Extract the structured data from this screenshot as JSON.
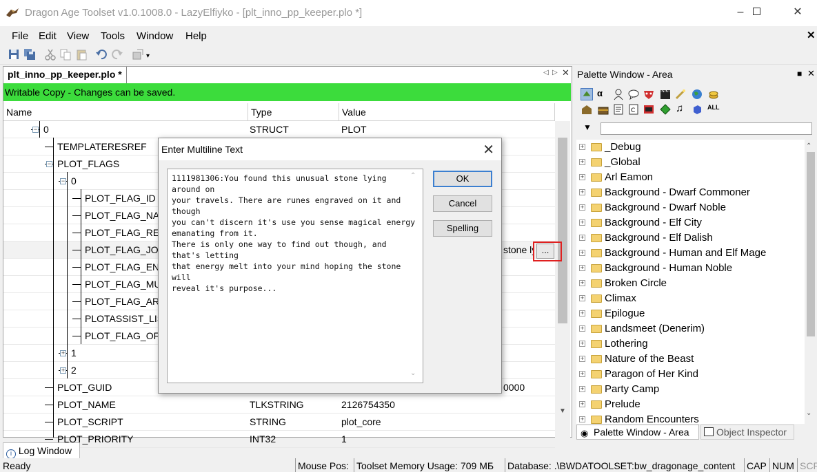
{
  "window": {
    "title": "Dragon Age Toolset v1.0.1008.0 - LazyElfiyko - [plt_inno_pp_keeper.plo *]"
  },
  "menu": [
    "File",
    "Edit",
    "View",
    "Tools",
    "Window",
    "Help"
  ],
  "document": {
    "tab_label": "plt_inno_pp_keeper.plo *",
    "status_banner": "Writable Copy - Changes can be saved.",
    "columns": {
      "name": "Name",
      "type": "Type",
      "value": "Value"
    },
    "rows": [
      {
        "name": "0",
        "type": "STRUCT",
        "value": "PLOT"
      },
      {
        "name": "TEMPLATERESREF",
        "type": "",
        "value": ""
      },
      {
        "name": "PLOT_FLAGS",
        "type": "",
        "value": ""
      },
      {
        "name": "0",
        "type": "",
        "value": ""
      },
      {
        "name": "PLOT_FLAG_ID",
        "type": "",
        "value": ""
      },
      {
        "name": "PLOT_FLAG_NAM",
        "type": "",
        "value": ""
      },
      {
        "name": "PLOT_FLAG_REW",
        "type": "",
        "value": ""
      },
      {
        "name": "PLOT_FLAG_JOU",
        "type": "",
        "value": "stone lyi"
      },
      {
        "name": "PLOT_FLAG_END",
        "type": "",
        "value": ""
      },
      {
        "name": "PLOT_FLAG_MUL",
        "type": "",
        "value": ""
      },
      {
        "name": "PLOT_FLAG_ARE",
        "type": "",
        "value": ""
      },
      {
        "name": "PLOTASSIST_LIST",
        "type": "",
        "value": ""
      },
      {
        "name": "PLOT_FLAG_OFF",
        "type": "",
        "value": ""
      },
      {
        "name": "1",
        "type": "",
        "value": ""
      },
      {
        "name": "2",
        "type": "",
        "value": ""
      },
      {
        "name": "PLOT_GUID",
        "type": "",
        "value": "0000"
      },
      {
        "name": "PLOT_NAME",
        "type": "TLKSTRING",
        "value": "2126754350"
      },
      {
        "name": "PLOT_SCRIPT",
        "type": "STRING",
        "value": "plot_core"
      },
      {
        "name": "PLOT_PRIORITY",
        "type": "INT32",
        "value": "1"
      }
    ],
    "ellipsis_button": "..."
  },
  "dialog": {
    "title": "Enter Multiline Text",
    "text": "1111981306:You found this unusual stone lying around on\nyour travels. There are runes engraved on it and though\nyou can't discern it's use you sense magical energy\nemanating from it.\nThere is only one way to find out though, and that's letting\nthat energy melt into your mind hoping the stone will\nreveal it's purpose...",
    "ok": "OK",
    "cancel": "Cancel",
    "spelling": "Spelling"
  },
  "palette": {
    "title": "Palette Window - Area",
    "items": [
      "_Debug",
      "_Global",
      "Arl Eamon",
      "Background - Dwarf Commoner",
      "Background - Dwarf Noble",
      "Background - Elf City",
      "Background - Elf Dalish",
      "Background - Human and Elf Mage",
      "Background - Human Noble",
      "Broken Circle",
      "Climax",
      "Epilogue",
      "Landsmeet (Denerim)",
      "Lothering",
      "Nature of the Beast",
      "Paragon of Her Kind",
      "Party Camp",
      "Prelude",
      "Random Encounters"
    ],
    "tab_palette": "Palette Window - Area",
    "tab_inspector": "Object Inspector"
  },
  "log_tab": "Log Window",
  "status": {
    "ready": "Ready",
    "mouse_pos": "Mouse Pos:",
    "memory": "Toolset Memory Usage: 709 МБ",
    "database": "Database: .\\BWDATOOLSET:bw_dragonage_content",
    "cap": "CAP",
    "num": "NUM",
    "scr": "SCR"
  }
}
